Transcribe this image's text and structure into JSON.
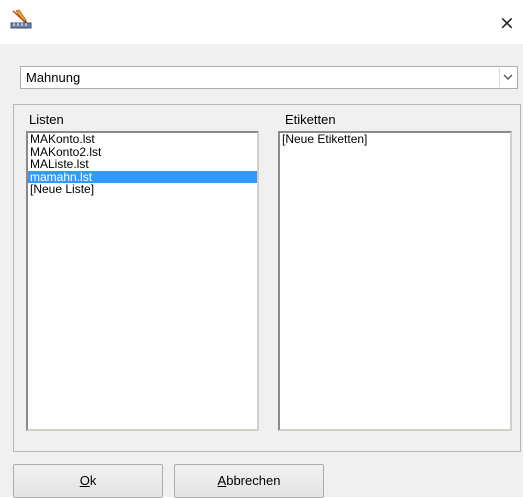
{
  "titlebar": {
    "close_glyph": "×"
  },
  "combo": {
    "selected": "Mahnung"
  },
  "lists": {
    "label": "Listen",
    "items": [
      {
        "label": "MAKonto.lst"
      },
      {
        "label": "MAKonto2.lst"
      },
      {
        "label": "MAListe.lst"
      },
      {
        "label": "mamahn.lst"
      },
      {
        "label": "[Neue Liste]"
      }
    ],
    "selected_index": 3
  },
  "labels": {
    "label": "Etiketten",
    "items": [
      {
        "label": "[Neue Etiketten]"
      }
    ]
  },
  "buttons": {
    "ok_mnemonic": "O",
    "ok_rest": "k",
    "cancel_mnemonic": "A",
    "cancel_rest": "bbrechen"
  },
  "colors": {
    "selection": "#3399ff",
    "background": "#f0f0f0"
  }
}
